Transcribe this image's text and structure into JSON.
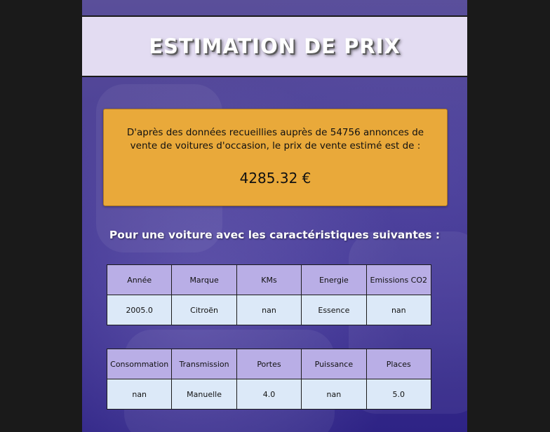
{
  "header": {
    "title": "ESTIMATION DE PRIX"
  },
  "estimate": {
    "description": "D'après des données recueillies auprès de 54756 annonces de vente de voitures d'occasion, le prix de vente estimé est de :",
    "price": "4285.32 €"
  },
  "subtitle": "Pour une voiture avec les caractéristiques suivantes :",
  "table1": {
    "headers": [
      "Année",
      "Marque",
      "KMs",
      "Energie",
      "Emissions CO2"
    ],
    "values": [
      "2005.0",
      "Citroën",
      "nan",
      "Essence",
      "nan"
    ]
  },
  "table2": {
    "headers": [
      "Consommation",
      "Transmission",
      "Portes",
      "Puissance",
      "Places"
    ],
    "values": [
      "nan",
      "Manuelle",
      "4.0",
      "nan",
      "5.0"
    ]
  },
  "colors": {
    "header_bg": "#e3dcf2",
    "price_box": "#e9a93a",
    "table_header": "#b9aee6",
    "table_cell": "#dce9f8",
    "page_bg": "#4b3f96"
  }
}
